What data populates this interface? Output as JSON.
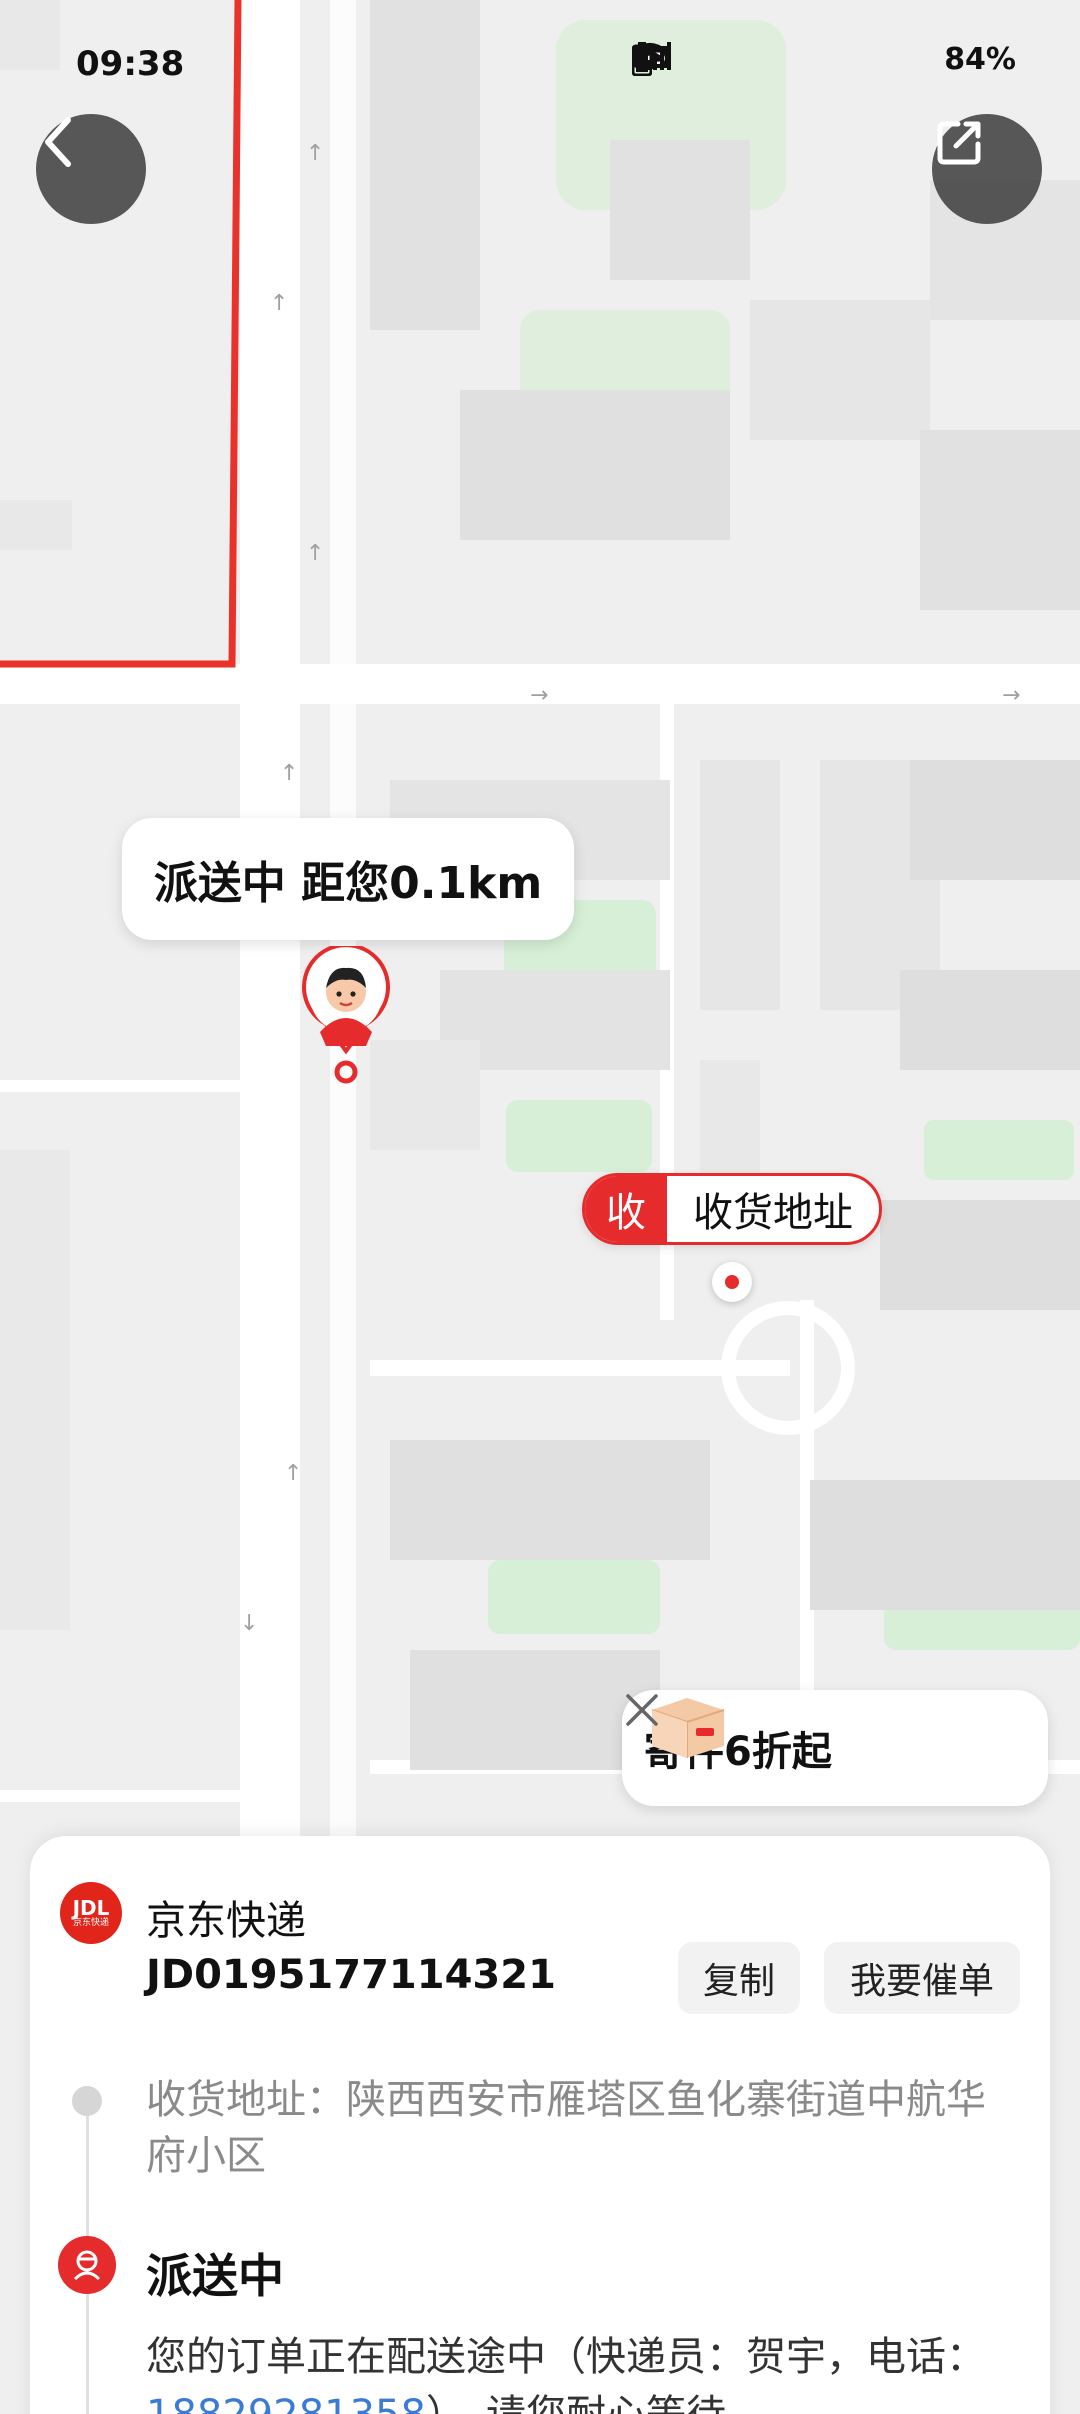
{
  "status_bar": {
    "time": "09:38",
    "battery": "84%"
  },
  "map": {
    "courier_bubble": "派送中 距您0.1km",
    "address_tag": "收",
    "address_label": "收货地址"
  },
  "promo": {
    "text": "寄件6折起"
  },
  "order": {
    "carrier_logo_text": "JDL",
    "carrier_logo_sub": "京东快递",
    "carrier_name": "京东快递",
    "tracking_number": "JD0195177114321",
    "copy_label": "复制",
    "urge_label": "我要催单",
    "address": "收货地址：陕西西安市雁塔区鱼化寨街道中航华府小区",
    "status_title": "派送中",
    "status_desc_prefix": "您的订单正在配送途中（快递员：贺宇，电话：",
    "courier_phone": "18829281358",
    "status_desc_suffix": "），请您耐心等待。"
  },
  "colors": {
    "accent_red": "#e52b2b",
    "link_blue": "#3a7bd5"
  }
}
